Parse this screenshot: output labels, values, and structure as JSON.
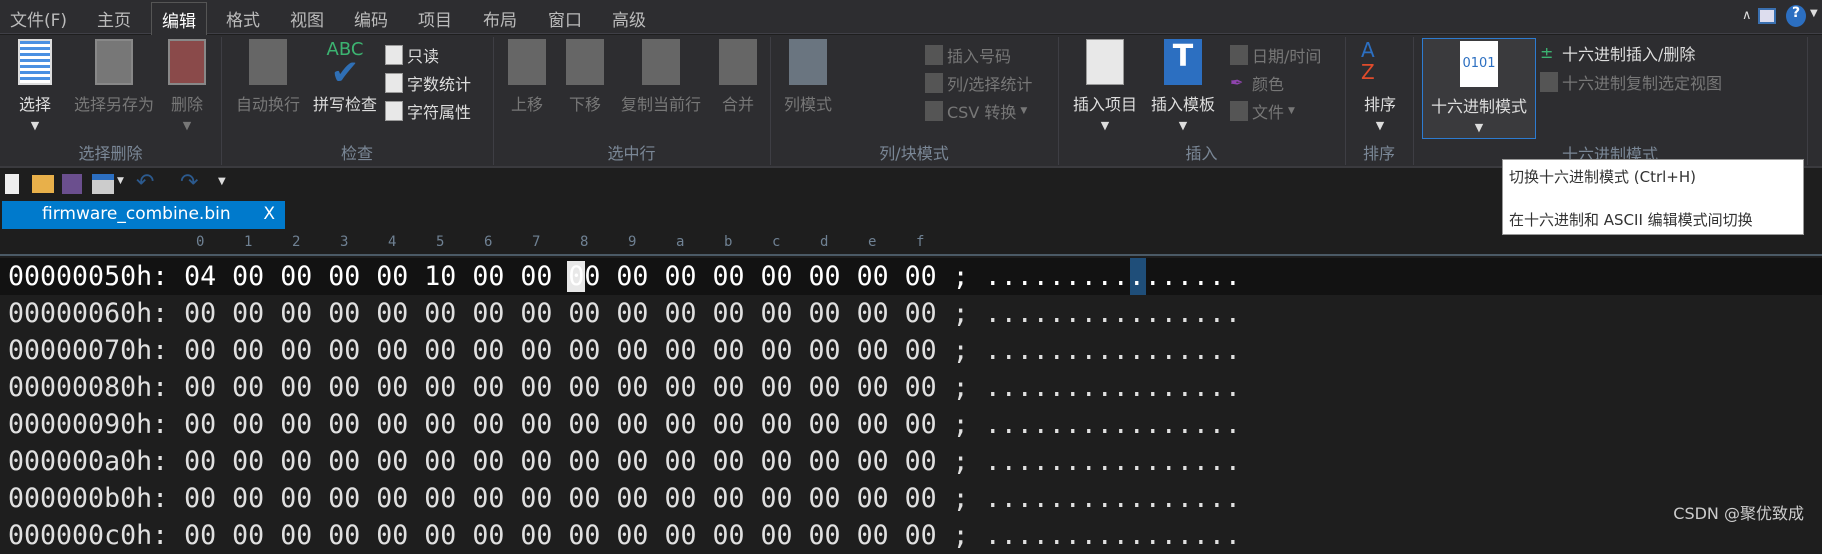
{
  "menu": [
    "文件(F)",
    "主页",
    "编辑",
    "格式",
    "视图",
    "编码",
    "项目",
    "布局",
    "窗口",
    "高级"
  ],
  "active_menu": "编辑",
  "ribbon": {
    "select_delete": {
      "select": "选择",
      "save_selection": "选择另存为",
      "delete": "删除",
      "label": "选择删除"
    },
    "check": {
      "auto_wrap": "自动换行",
      "spell_check": "拼写检查",
      "spell_icon_text": "ABC",
      "read_only": "只读",
      "word_count": "字数统计",
      "char_props": "字符属性",
      "label": "检查"
    },
    "selected_lines": {
      "move_up": "上移",
      "move_down": "下移",
      "duplicate": "复制当前行",
      "merge": "合并",
      "label": "选中行"
    },
    "column": {
      "column_mode": "列模式",
      "insert_number": "插入号码",
      "col_stats": "列/选择统计",
      "csv": "CSV 转换",
      "label": "列/块模式"
    },
    "insert": {
      "insert_item": "插入项目",
      "insert_template": "插入模板",
      "datetime": "日期/时间",
      "color": "颜色",
      "file": "文件",
      "label": "插入"
    },
    "sort": {
      "sort": "排序",
      "label": "排序"
    },
    "hex": {
      "hex_mode": "十六进制模式",
      "icon_text": "0101",
      "hex_insert_delete": "十六进制插入/删除",
      "hex_copy_view": "十六进制复制选定视图",
      "label": "十六进制模式"
    }
  },
  "tab": {
    "name": "firmware_combine.bin",
    "close": "X"
  },
  "ruler": [
    "0",
    "1",
    "2",
    "3",
    "4",
    "5",
    "6",
    "7",
    "8",
    "9",
    "a",
    "b",
    "c",
    "d",
    "e",
    "f"
  ],
  "rows": [
    {
      "offset": "00000050h:",
      "bytes": "04 00 00 00 00 10 00 00 00 00 00 00 00 00 00 00",
      "ascii": "................"
    },
    {
      "offset": "00000060h:",
      "bytes": "00 00 00 00 00 00 00 00 00 00 00 00 00 00 00 00",
      "ascii": "................"
    },
    {
      "offset": "00000070h:",
      "bytes": "00 00 00 00 00 00 00 00 00 00 00 00 00 00 00 00",
      "ascii": "................"
    },
    {
      "offset": "00000080h:",
      "bytes": "00 00 00 00 00 00 00 00 00 00 00 00 00 00 00 00",
      "ascii": "................"
    },
    {
      "offset": "00000090h:",
      "bytes": "00 00 00 00 00 00 00 00 00 00 00 00 00 00 00 00",
      "ascii": "................"
    },
    {
      "offset": "000000a0h:",
      "bytes": "00 00 00 00 00 00 00 00 00 00 00 00 00 00 00 00",
      "ascii": "................"
    },
    {
      "offset": "000000b0h:",
      "bytes": "00 00 00 00 00 00 00 00 00 00 00 00 00 00 00 00",
      "ascii": "................"
    },
    {
      "offset": "000000c0h:",
      "bytes": "00 00 00 00 00 00 00 00 00 00 00 00 00 00 00 00",
      "ascii": "................"
    }
  ],
  "separator": ";",
  "tooltip": {
    "title": "切换十六进制模式 (Ctrl+H)",
    "desc": "在十六进制和 ASCII 编辑模式间切换"
  },
  "watermark": "CSDN @聚优致成",
  "colors": {
    "accent": "#007acc",
    "background": "#1e1e1e",
    "ribbon": "#2d2d30"
  }
}
